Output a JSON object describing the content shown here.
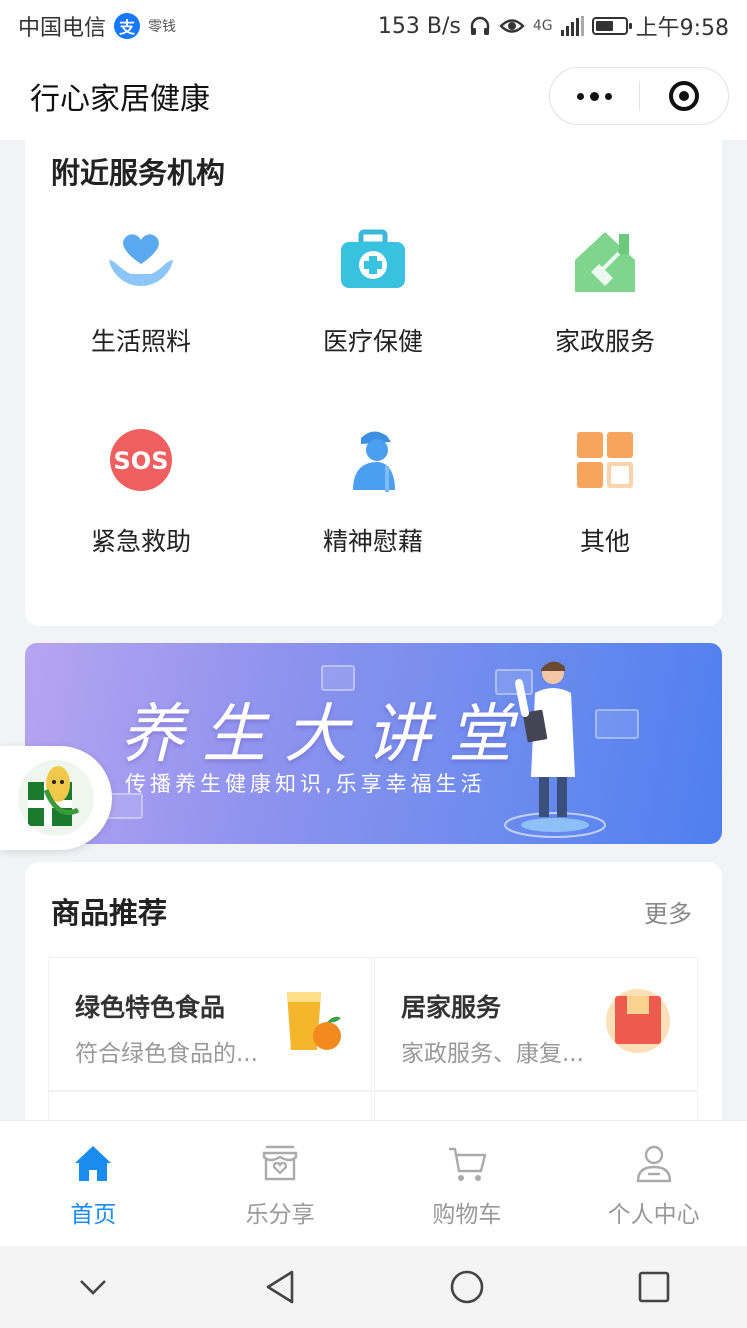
{
  "status_bar": {
    "carrier": "中国电信",
    "alipay_badge": "支",
    "extra": "零钱",
    "network_speed": "153 B/s",
    "network_type": "4G",
    "time": "上午9:58",
    "battery_level": 0.6
  },
  "nav": {
    "title": "行心家居健康"
  },
  "services": {
    "title": "附近服务机构",
    "items": [
      {
        "label": "生活照料",
        "icon": "heart-hands-icon"
      },
      {
        "label": "医疗保健",
        "icon": "medical-kit-icon"
      },
      {
        "label": "家政服务",
        "icon": "house-broom-icon"
      },
      {
        "label": "紧急救助",
        "icon": "sos-icon"
      },
      {
        "label": "精神慰藉",
        "icon": "elder-person-icon"
      },
      {
        "label": "其他",
        "icon": "grid-icon"
      }
    ]
  },
  "banner": {
    "title": "养生大讲堂",
    "subtitle": "传播养生健康知识,乐享幸福生活"
  },
  "products": {
    "title": "商品推荐",
    "more": "更多",
    "items": [
      {
        "name": "绿色特色食品",
        "desc": "符合绿色食品的...",
        "icon": "juice-orange-icon"
      },
      {
        "name": "居家服务",
        "desc": "家政服务、康复...",
        "icon": "box-icon"
      }
    ]
  },
  "tabs": [
    {
      "label": "首页",
      "icon": "home-icon",
      "active": true
    },
    {
      "label": "乐分享",
      "icon": "share-shop-icon",
      "active": false
    },
    {
      "label": "购物车",
      "icon": "cart-icon",
      "active": false
    },
    {
      "label": "个人中心",
      "icon": "user-icon",
      "active": false
    }
  ],
  "colors": {
    "accent": "#1a8cf0",
    "background": "#f2f3f5"
  }
}
